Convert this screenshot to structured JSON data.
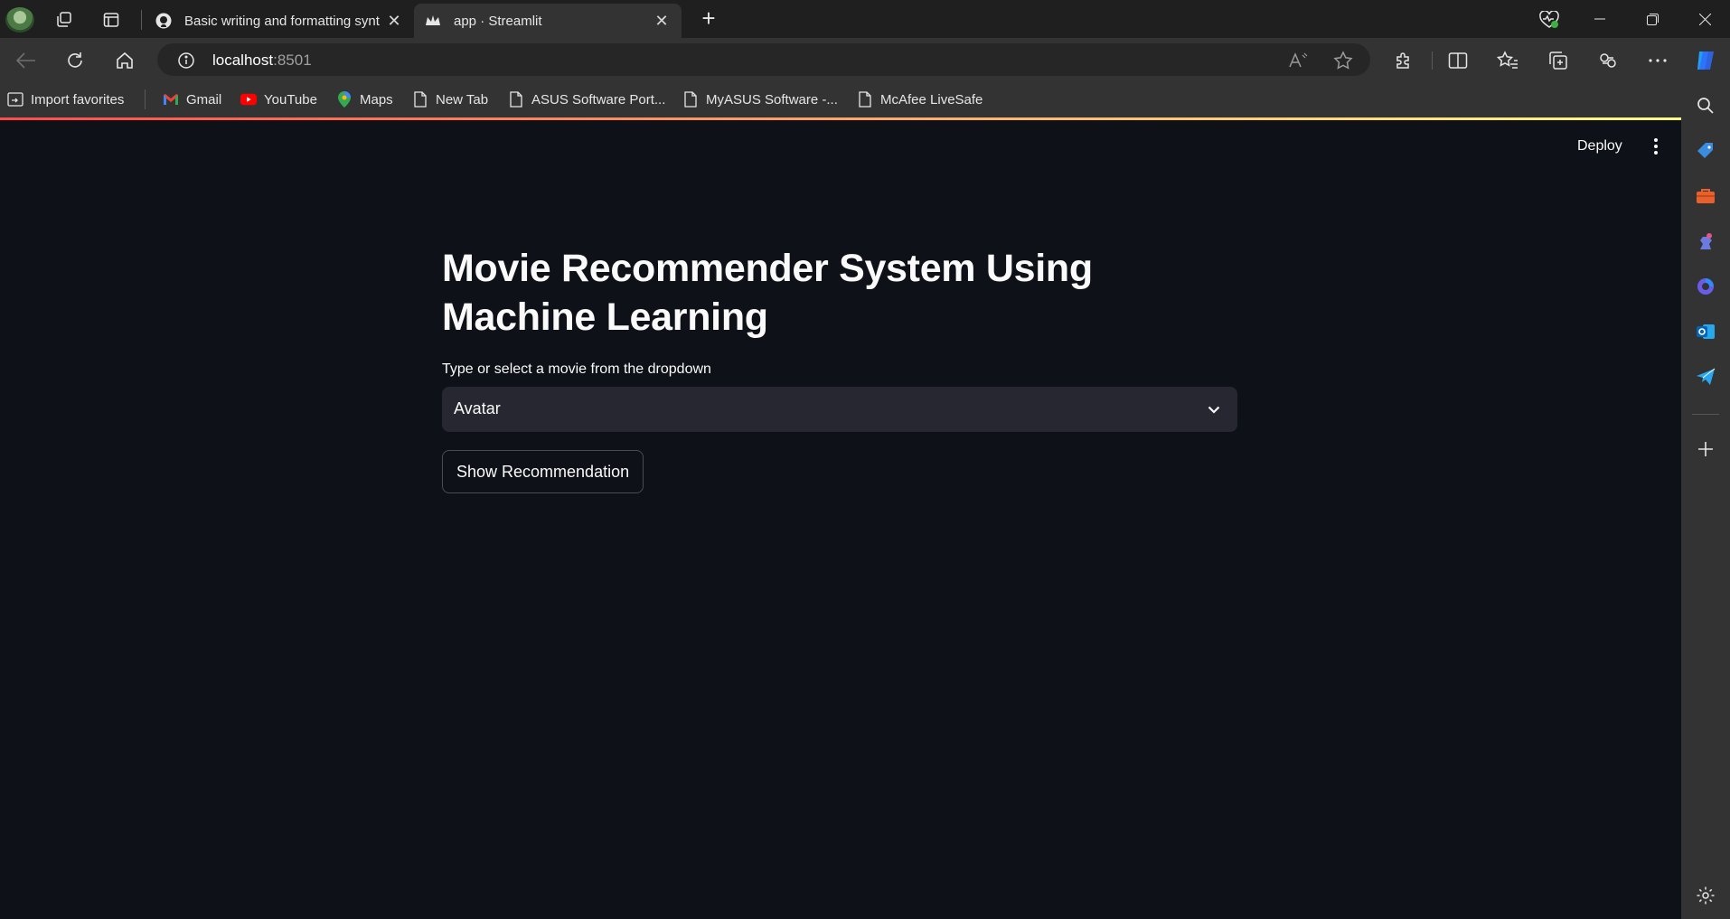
{
  "browser": {
    "tabs": [
      {
        "title": "Basic writing and formatting synt",
        "favicon": "github-icon",
        "active": false
      },
      {
        "title": "app · Streamlit",
        "favicon": "streamlit-crown-icon",
        "active": true
      }
    ],
    "address": {
      "host": "localhost",
      "port": ":8501"
    },
    "bookmarks": [
      {
        "label": "Import favorites",
        "icon": "import-icon"
      },
      {
        "label": "Gmail",
        "icon": "gmail-icon"
      },
      {
        "label": "YouTube",
        "icon": "youtube-icon"
      },
      {
        "label": "Maps",
        "icon": "maps-pin-icon"
      },
      {
        "label": "New Tab",
        "icon": "page-icon"
      },
      {
        "label": "ASUS Software Port...",
        "icon": "page-icon"
      },
      {
        "label": "MyASUS Software -...",
        "icon": "page-icon"
      },
      {
        "label": "McAfee LiveSafe",
        "icon": "page-icon"
      }
    ]
  },
  "app": {
    "header": {
      "deploy_label": "Deploy"
    },
    "title": "Movie Recommender System Using Machine Learning",
    "select_label": "Type or select a movie from the dropdown",
    "selected_movie": "Avatar",
    "button_label": "Show Recommendation"
  },
  "colors": {
    "background": "#0e1117",
    "select_bg": "#262730",
    "text": "#fafafa",
    "decoration_start": "#ff4b4b",
    "decoration_end": "#fffd80"
  }
}
